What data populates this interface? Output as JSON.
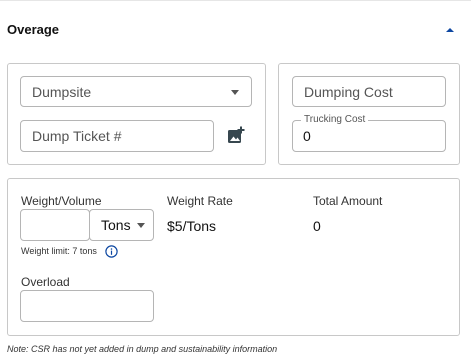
{
  "section": {
    "title": "Overage",
    "collapse_icon": "chevron-up-icon"
  },
  "dump": {
    "dumpsite_placeholder": "Dumpsite",
    "dump_ticket_placeholder": "Dump Ticket #",
    "add_photo_icon": "add-photo-icon",
    "dumping_cost_placeholder": "Dumping Cost",
    "trucking_cost_label": "Trucking Cost",
    "trucking_cost_value": "0"
  },
  "overage": {
    "weight_volume_label": "Weight/Volume",
    "weight_value": "",
    "unit_value": "Tons",
    "weight_rate_label": "Weight Rate",
    "weight_rate_value": "$5/Tons",
    "total_amount_label": "Total Amount",
    "total_amount_value": "0",
    "weight_limit_text": "Weight limit: 7 tons",
    "info_icon": "info-icon",
    "overload_label": "Overload",
    "overload_value": ""
  },
  "note": "Note: CSR has not yet added in dump and sustainability information",
  "colors": {
    "accent": "#0d47a1",
    "border": "#c8c8c8",
    "text": "#212121"
  }
}
